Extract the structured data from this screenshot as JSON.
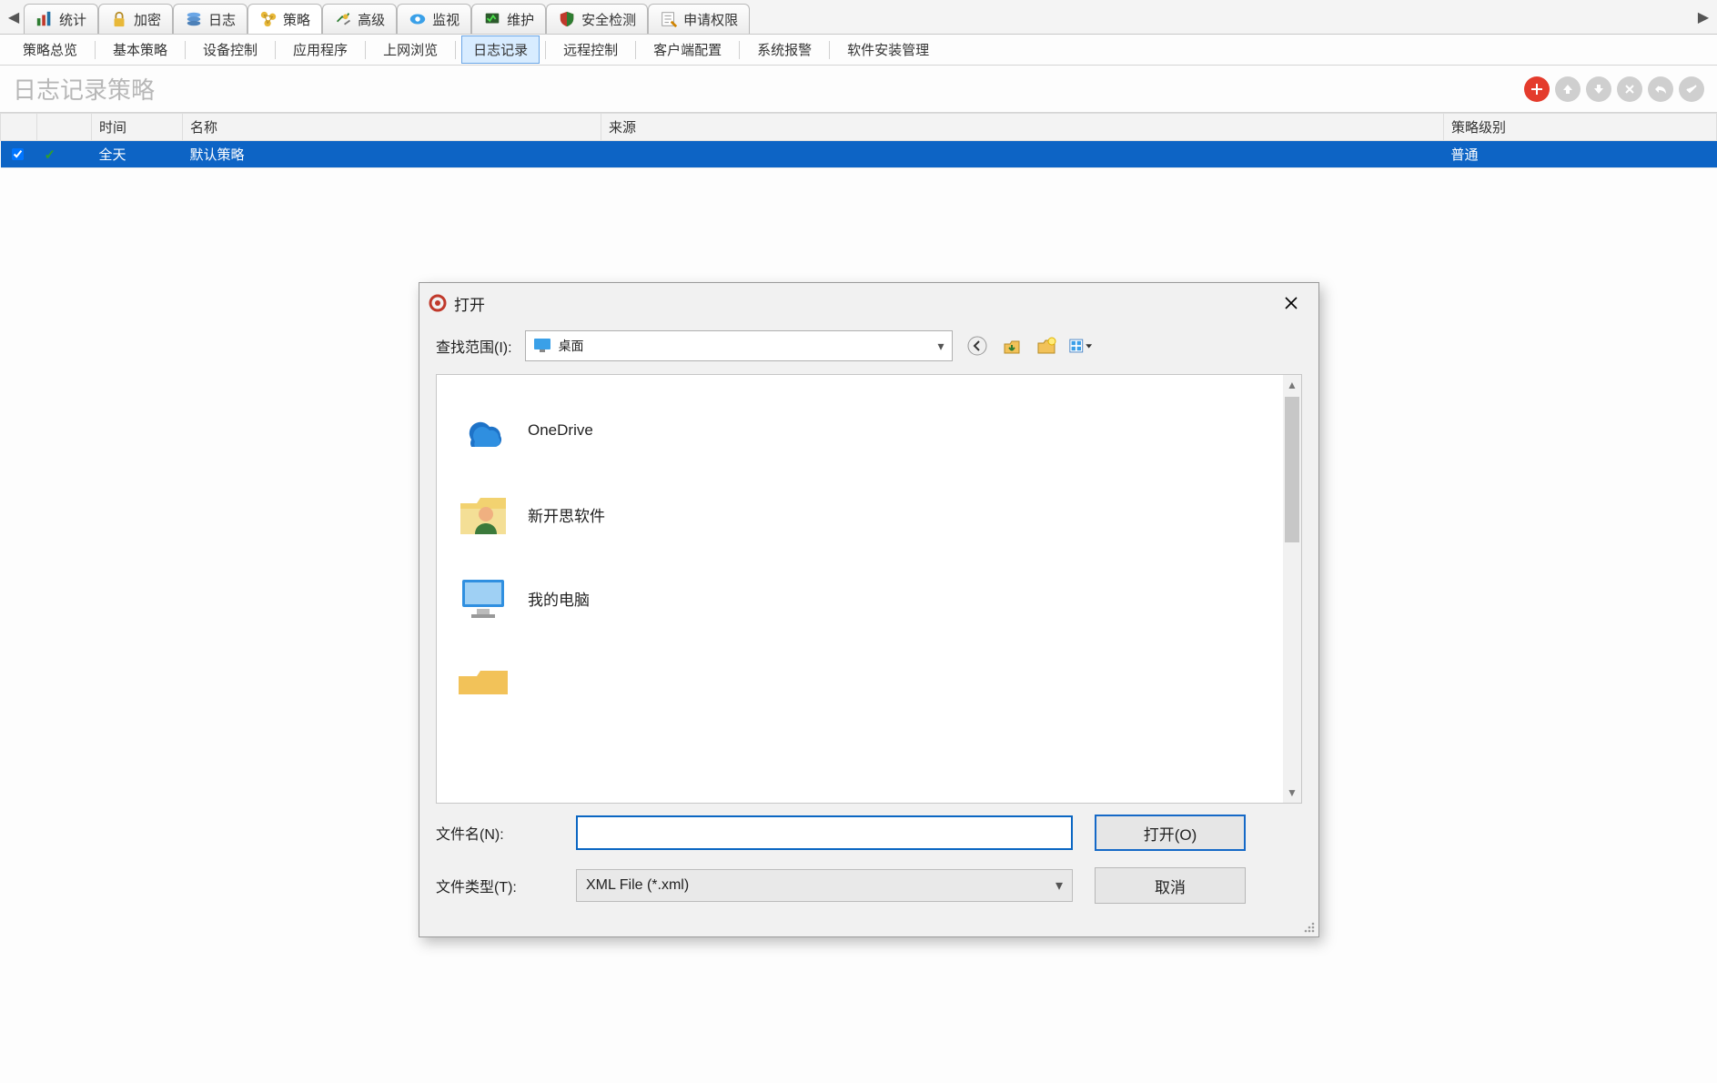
{
  "tabs": [
    {
      "icon": "stats",
      "label": "统计"
    },
    {
      "icon": "lock",
      "label": "加密"
    },
    {
      "icon": "log",
      "label": "日志"
    },
    {
      "icon": "policy",
      "label": "策略",
      "active": true
    },
    {
      "icon": "advanced",
      "label": "高级"
    },
    {
      "icon": "monitor",
      "label": "监视"
    },
    {
      "icon": "maintain",
      "label": "维护"
    },
    {
      "icon": "security",
      "label": "安全检测"
    },
    {
      "icon": "permission",
      "label": "申请权限"
    }
  ],
  "subtabs": [
    {
      "label": "策略总览"
    },
    {
      "label": "基本策略"
    },
    {
      "label": "设备控制"
    },
    {
      "label": "应用程序"
    },
    {
      "label": "上网浏览"
    },
    {
      "label": "日志记录",
      "active": true
    },
    {
      "label": "远程控制"
    },
    {
      "label": "客户端配置"
    },
    {
      "label": "系统报警"
    },
    {
      "label": "软件安装管理"
    }
  ],
  "page_title": "日志记录策略",
  "action_buttons": {
    "add": "+",
    "up": "↑",
    "down": "↓",
    "delete": "×",
    "undo": "↶",
    "confirm": "✓"
  },
  "table": {
    "headers": {
      "check": "",
      "time": "时间",
      "name": "名称",
      "source": "来源",
      "level": "策略级别"
    },
    "rows": [
      {
        "checked": true,
        "ok": true,
        "time": "全天",
        "name": "默认策略",
        "source": "",
        "level": "普通",
        "selected": true
      }
    ]
  },
  "dialog": {
    "title": "打开",
    "lookin_label": "查找范围(I):",
    "lookin_value": "桌面",
    "nav": {
      "back": "back",
      "up": "up",
      "newfolder": "newfolder",
      "viewmenu": "viewmenu"
    },
    "items": [
      {
        "icon": "onedrive",
        "label": "OneDrive"
      },
      {
        "icon": "userfolder",
        "label": "新开思软件"
      },
      {
        "icon": "computer",
        "label": "我的电脑"
      },
      {
        "icon": "folder",
        "label": ""
      }
    ],
    "filename_label": "文件名(N):",
    "filename_value": "",
    "filetype_label": "文件类型(T):",
    "filetype_value": "XML File (*.xml)",
    "open_btn": "打开(O)",
    "cancel_btn": "取消"
  }
}
